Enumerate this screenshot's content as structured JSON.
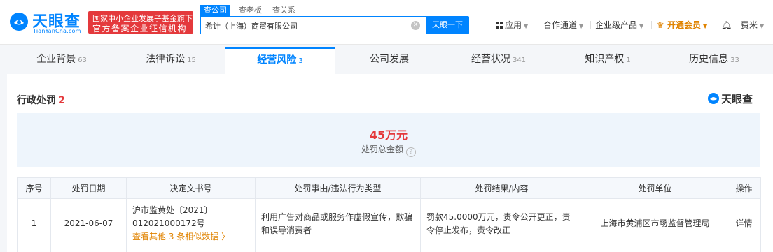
{
  "brand": {
    "name": "天眼查",
    "domain": "TianYanCha.com",
    "badge_line1": "国家中小企业发展子基金旗下",
    "badge_line2": "官方备案企业征信机构",
    "color": "#0084ff"
  },
  "search": {
    "tabs": [
      "查公司",
      "查老板",
      "查关系"
    ],
    "active_tab": "查公司",
    "value": "希计（上海）商贸有限公司",
    "button": "天眼一下"
  },
  "topnav": {
    "apps": "应用",
    "partner": "合作通道",
    "enterprise": "企业级产品",
    "vip": "开通会员",
    "user": "费米"
  },
  "tabs": [
    {
      "label": "企业背景",
      "count": "63"
    },
    {
      "label": "法律诉讼",
      "count": "15"
    },
    {
      "label": "经营风险",
      "count": "3",
      "active": true
    },
    {
      "label": "公司发展",
      "count": ""
    },
    {
      "label": "经营状况",
      "count": "341"
    },
    {
      "label": "知识产权",
      "count": "1"
    },
    {
      "label": "历史信息",
      "count": "33"
    }
  ],
  "section": {
    "title": "行政处罚",
    "count": "2",
    "watermark": "天眼查"
  },
  "summary": {
    "amount": "45万元",
    "label": "处罚总金额"
  },
  "table": {
    "headers": [
      "序号",
      "处罚日期",
      "决定文书号",
      "处罚事由/违法行为类型",
      "处罚结果/内容",
      "处罚单位",
      "操作"
    ],
    "rows": [
      {
        "index": "1",
        "date": "2021-06-07",
        "doc_line1": "沪市监黄处〔2021〕",
        "doc_line2": "012021000172号",
        "doc_more": "查看其他 3 条相似数据",
        "reason": "利用广告对商品或服务作虚假宣传，欺骗和误导消费者",
        "result": "罚款45.0000万元，责令公开更正，责令停止发布，责令改正",
        "unit": "上海市黄浦区市场监督管理局",
        "action": "详情"
      }
    ]
  },
  "colors": {
    "accent": "#0084ff",
    "danger": "#e4393c",
    "more": "#e08300",
    "summary_bg": "#eef5fc"
  }
}
